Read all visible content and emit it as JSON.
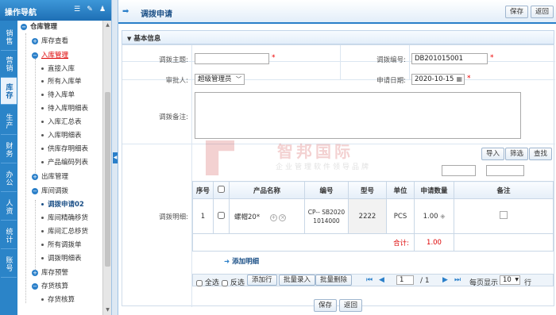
{
  "sidebar": {
    "title": "操作导航",
    "header_icons": [
      "list-icon",
      "wrench-icon",
      "user-icon"
    ],
    "tabs": [
      "销售",
      "营销",
      "库存",
      "生产",
      "财务",
      "办公",
      "人资",
      "统计",
      "账号"
    ],
    "active_tab": "库存",
    "tree": {
      "root": "仓库管理",
      "stock_view": "库存查看",
      "inbound": "入库管理",
      "inbound_items": [
        "直接入库",
        "所有入库单",
        "待入库单",
        "待入库明细表",
        "入库汇总表",
        "入库明细表",
        "供库存明细表",
        "产品编码列表"
      ],
      "outbound": "出库管理",
      "transfer": "库间调拨",
      "transfer_items": [
        "调拨申请02",
        "库间精确移货",
        "库间汇总移货",
        "所有调拨单",
        "调拨明细表"
      ],
      "warning": "库存预警",
      "accounting": "存货核算",
      "accounting_items": [
        "存货核算"
      ]
    }
  },
  "page": {
    "title": "调拨申请",
    "save": "保存",
    "back": "返回",
    "section": "基本信息"
  },
  "form": {
    "subject_label": "调拨主题:",
    "subject_value": "",
    "number_label": "调拨编号:",
    "number_value": "DB201015001",
    "approver_label": "审批人:",
    "approver_value": "超级管理员",
    "date_label": "申请日期:",
    "date_value": "2020-10-15",
    "remark_label": "调拨备注:",
    "detail_label": "调拨明细:"
  },
  "watermark": {
    "name": "智邦国际",
    "slogan": "企业管理软件领导品牌"
  },
  "detail": {
    "import": "导入",
    "filter": "筛选",
    "search": "查找",
    "columns": [
      "序号",
      "",
      "产品名称",
      "编号",
      "型号",
      "单位",
      "申请数量",
      "备注"
    ],
    "rows": [
      {
        "no": "1",
        "name": "螺帽20*",
        "code": "CP-- SB20201014000",
        "model": "2222",
        "unit": "PCS",
        "qty": "1.00",
        "remark": ""
      }
    ],
    "total_label": "合计:",
    "total_value": "1.00",
    "add_detail": "添加明细"
  },
  "pager": {
    "select_all": "全选",
    "invert": "反选",
    "add_row": "添加行",
    "batch_import": "批量录入",
    "batch_delete": "批量删除",
    "page": "1",
    "total": "/ 1",
    "per_page_label": "每页显示",
    "per_page": "10",
    "unit": "行"
  },
  "footer": {
    "save": "保存",
    "back": "返回"
  }
}
